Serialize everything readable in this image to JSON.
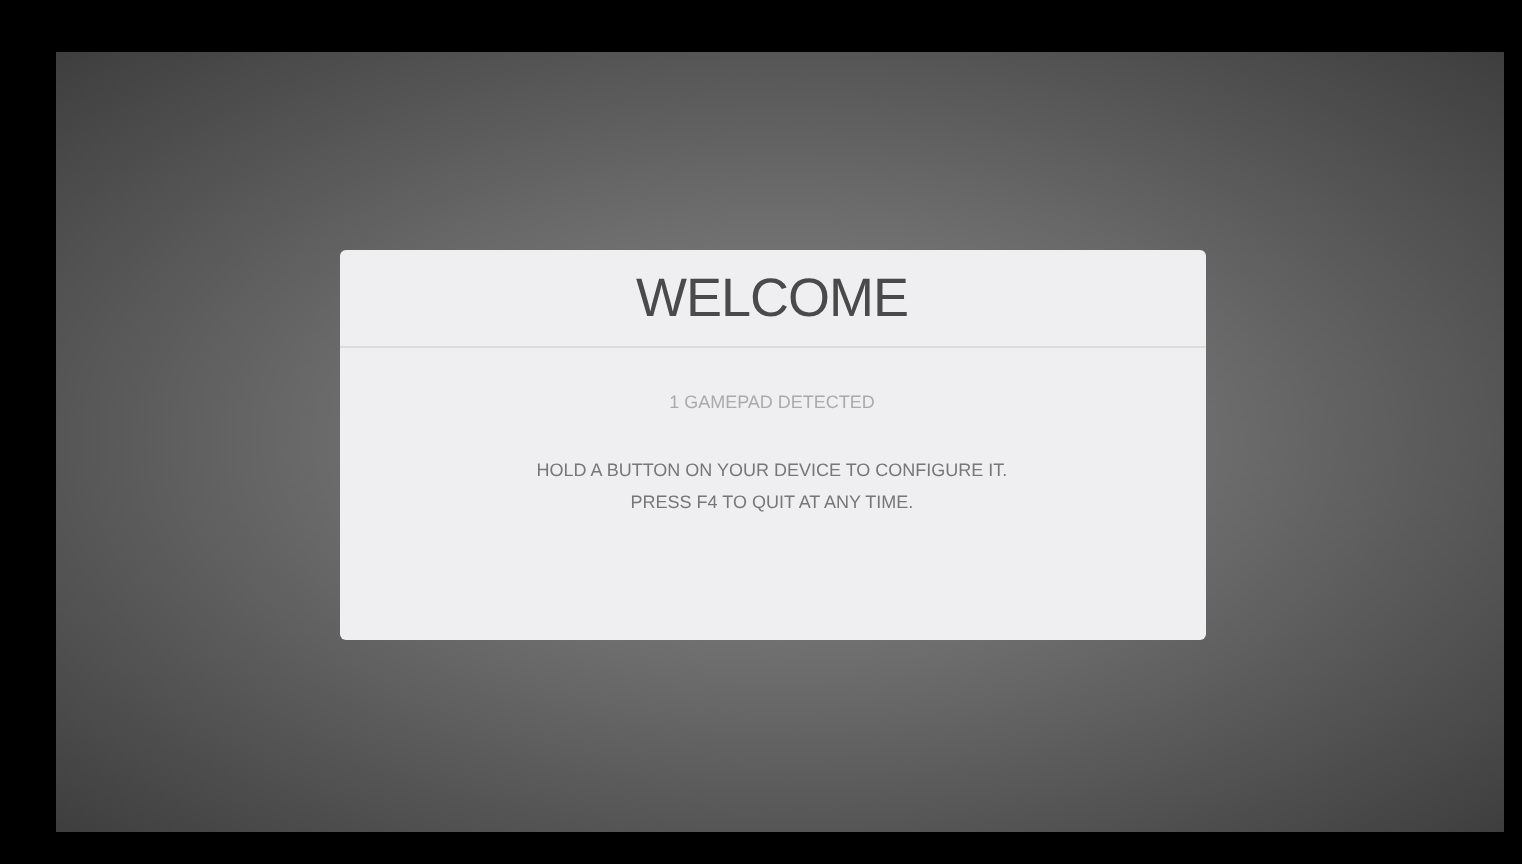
{
  "dialog": {
    "title": "WELCOME",
    "status": "1 GAMEPAD DETECTED",
    "message_lines": [
      "HOLD A BUTTON ON YOUR DEVICE TO CONFIGURE IT.",
      "PRESS F4 TO QUIT AT ANY TIME."
    ]
  }
}
